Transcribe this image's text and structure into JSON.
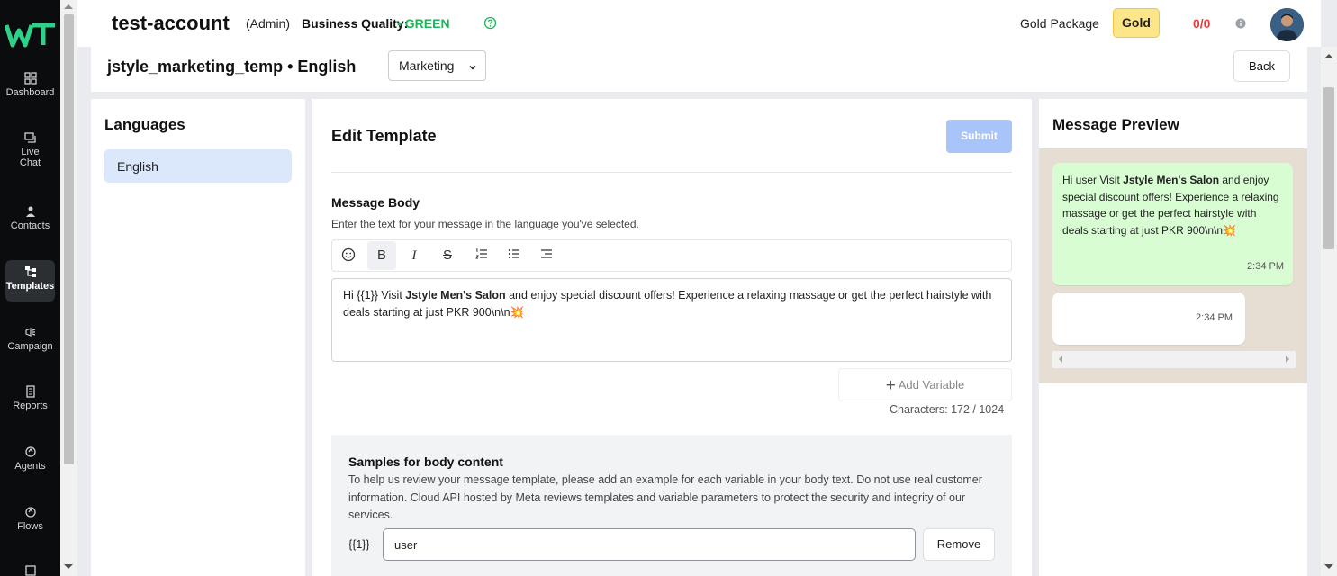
{
  "sidebar": {
    "items": [
      {
        "label": "Dashboard",
        "icon": "dashboard-icon"
      },
      {
        "label": "Live",
        "label2": "Chat",
        "icon": "live-chat-icon"
      },
      {
        "label": "Contacts",
        "icon": "contacts-icon"
      },
      {
        "label": "Templates",
        "icon": "templates-icon",
        "active": true
      },
      {
        "label": "Campaign",
        "icon": "campaign-icon"
      },
      {
        "label": "Reports",
        "icon": "reports-icon"
      },
      {
        "label": "Agents",
        "icon": "agents-icon"
      },
      {
        "label": "Flows",
        "icon": "flows-icon"
      }
    ]
  },
  "header": {
    "account": "test-account",
    "role": "(Admin)",
    "quality_label": "Business Quality:",
    "quality_value": "• GREEN",
    "package_label": "Gold Package",
    "package_badge": "Gold",
    "credits": "0/0"
  },
  "template": {
    "name": "jstyle_marketing_temp • English",
    "category": "Marketing",
    "back_label": "Back"
  },
  "languages": {
    "title": "Languages",
    "items": [
      "English"
    ]
  },
  "editor": {
    "title": "Edit Template",
    "submit_label": "Submit",
    "body_title": "Message Body",
    "body_desc": "Enter the text for your message in the language you've selected.",
    "body_prefix": "Hi {{1}} Visit ",
    "body_bold": "Jstyle Men's Salon",
    "body_rest": " and enjoy special discount offers! Experience a relaxing massage or get the perfect hairstyle with deals starting at just PKR 900\\n\\n",
    "body_emoji": "💥",
    "add_variable": "Add Variable",
    "characters": "Characters: 172 / 1024"
  },
  "samples": {
    "title": "Samples for body content",
    "desc": "To help us review your message template, please add an example for each variable in your body text. Do not use real customer information. Cloud API hosted by Meta reviews templates and variable parameters to protect the security and integrity of our services.",
    "var_label": "{{1}}",
    "var_value": "user",
    "remove_label": "Remove"
  },
  "preview": {
    "title": "Message Preview",
    "msg_prefix": "Hi user Visit ",
    "msg_bold": "Jstyle Men's Salon",
    "msg_rest": " and enjoy special discount offers! Experience a relaxing massage or get the perfect hairstyle with deals starting at just PKR 900\\n\\n",
    "msg_emoji": "💥",
    "time1": "2:34 PM",
    "time2": "2:34 PM"
  },
  "colors": {
    "sidebar_bg": "#0b0c0e",
    "quality_green": "#1fb35a",
    "credits_red": "#e53e3e",
    "gold_badge": "#fde68a",
    "submit_disabled": "#a9c4f8",
    "language_selected": "#dbe8fb",
    "preview_bubble": "#d9fdd3"
  }
}
